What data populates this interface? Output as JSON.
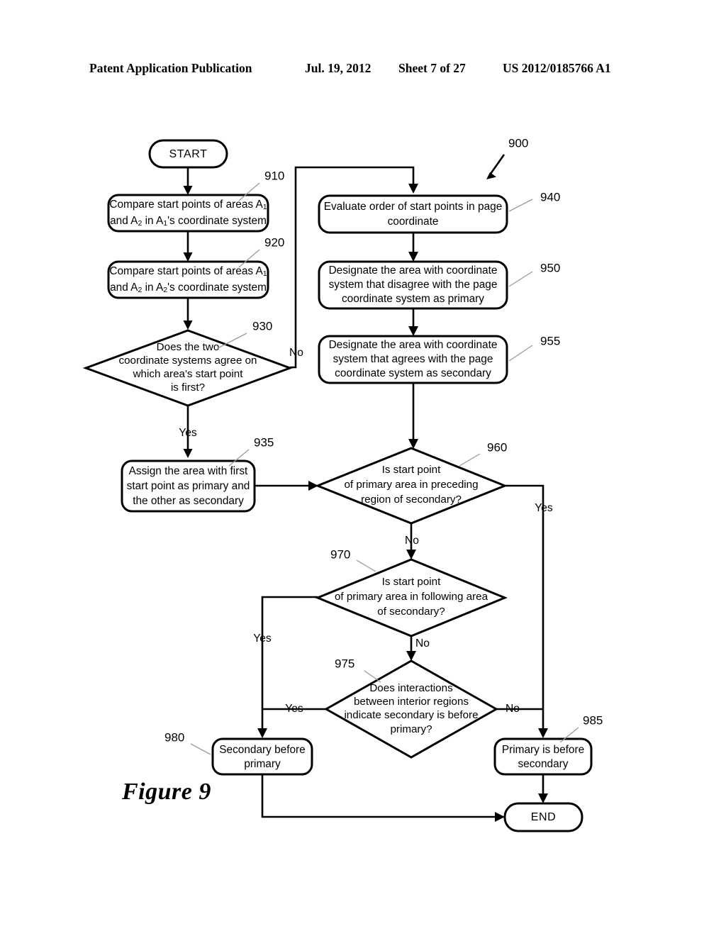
{
  "header": {
    "publication": "Patent Application Publication",
    "date": "Jul. 19, 2012",
    "sheet": "Sheet 7 of 27",
    "patent_number": "US 2012/0185766 A1"
  },
  "figure": {
    "caption": "Figure 9",
    "diagram_ref": "900"
  },
  "nodes": {
    "start": {
      "ref": "",
      "label": "START"
    },
    "n910": {
      "ref": "910",
      "line1_pre": "Compare start points of areas A",
      "line1_sub": "1",
      "line2_a": "and A",
      "line2_sub1": "2",
      "line2_b": " in A",
      "line2_sub2": "1",
      "line2_c": "'s coordinate system"
    },
    "n920": {
      "ref": "920",
      "line1_pre": "Compare start points of areas A",
      "line1_sub": "1",
      "line2_a": "and A",
      "line2_sub1": "2",
      "line2_b": " in A",
      "line2_sub2": "2",
      "line2_c": "'s coordinate system"
    },
    "n930": {
      "ref": "930",
      "line1": "Does the two",
      "line2": "coordinate systems agree on",
      "line3": "which area's start point",
      "line4": "is first?"
    },
    "n935": {
      "ref": "935",
      "line1": "Assign the area with first",
      "line2": "start point as primary and",
      "line3": "the other as secondary"
    },
    "n940": {
      "ref": "940",
      "line1": "Evaluate order of start points in page",
      "line2": "coordinate"
    },
    "n950": {
      "ref": "950",
      "line1": "Designate the area with coordinate",
      "line2": "system that disagree with the page",
      "line3": "coordinate system as primary"
    },
    "n955": {
      "ref": "955",
      "line1": "Designate the area with coordinate",
      "line2": "system that agrees with the page",
      "line3": "coordinate system as secondary"
    },
    "n960": {
      "ref": "960",
      "line1": "Is start point",
      "line2": "of primary area in preceding",
      "line3": "region of secondary?"
    },
    "n970": {
      "ref": "970",
      "line1": "Is start point",
      "line2": "of primary area in following area",
      "line3": "of secondary?"
    },
    "n975": {
      "ref": "975",
      "line1": "Does interactions",
      "line2": "between interior regions",
      "line3": "indicate secondary is before",
      "line4": "primary?"
    },
    "n980": {
      "ref": "980",
      "line1": "Secondary before",
      "line2": "primary"
    },
    "n985": {
      "ref": "985",
      "line1": "Primary is before",
      "line2": "secondary"
    },
    "end": {
      "ref": "",
      "label": "END"
    }
  },
  "edge_labels": {
    "d930_no": "No",
    "d930_yes": "Yes",
    "d960_yes": "Yes",
    "d960_no": "No",
    "d970_yes": "Yes",
    "d970_no": "No",
    "d975_yes": "Yes",
    "d975_no": "No"
  },
  "colors": {
    "ink": "#000000",
    "paper": "#ffffff",
    "leader": "#9a9a9a"
  }
}
